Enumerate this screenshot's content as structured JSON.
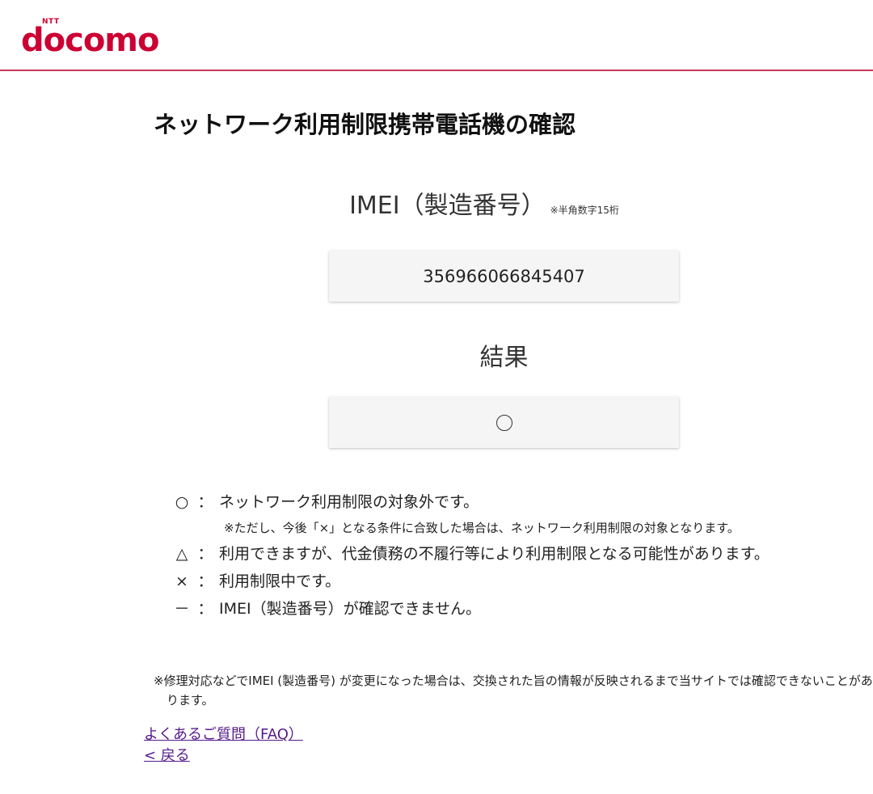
{
  "header": {
    "logo_text": "docomo",
    "logo_super": "NTT",
    "accent_color": "#cc0033"
  },
  "page": {
    "title": "ネットワーク利用制限携帯電話機の確認"
  },
  "imei": {
    "label": "IMEI（製造番号）",
    "note": "※半角数字15桁",
    "value": "356966066845407"
  },
  "result": {
    "label": "結果",
    "value": "○"
  },
  "legend": {
    "items": [
      {
        "symbol": "○",
        "colon": "：",
        "text": "ネットワーク利用制限の対象外です。"
      },
      {
        "sub": "※ただし、今後「×」となる条件に合致した場合は、ネットワーク利用制限の対象となります。"
      },
      {
        "symbol": "△",
        "colon": "：",
        "text": "利用できますが、代金債務の不履行等により利用制限となる可能性があります。"
      },
      {
        "symbol": "×",
        "colon": "：",
        "text": "利用制限中です。"
      },
      {
        "symbol": "－",
        "colon": "：",
        "text": "IMEI（製造番号）が確認できません。"
      }
    ]
  },
  "footnote": "※修理対応などでIMEI (製造番号) が変更になった場合は、交換された旨の情報が反映されるまで当サイトでは確認できないことがあります。",
  "links": {
    "faq": "よくあるご質問（FAQ）",
    "back": "< 戻る"
  }
}
